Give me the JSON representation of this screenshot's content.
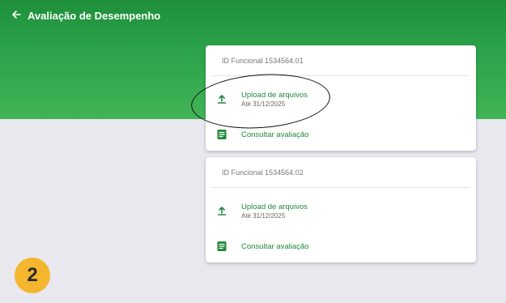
{
  "header": {
    "back_icon": "arrow-left-icon",
    "title": "Avaliação de Desempenho"
  },
  "cards": [
    {
      "id_label": "ID Funcional 1534564.01",
      "upload": {
        "icon": "upload-icon",
        "label": "Upload de arquivos",
        "deadline": "Até 31/12/2025"
      },
      "consult": {
        "icon": "document-icon",
        "label": "Consultar avaliação"
      }
    },
    {
      "id_label": "ID Funcional 1534564.02",
      "upload": {
        "icon": "upload-icon",
        "label": "Upload de arquivos",
        "deadline": "Até 31/12/2025"
      },
      "consult": {
        "icon": "document-icon",
        "label": "Consultar avaliação"
      }
    }
  ],
  "step_badge": "2",
  "colors": {
    "primary_green": "#2aa24a",
    "link_green": "#1e8a3b",
    "badge": "#f4b62f",
    "background": "#e9e8ee"
  }
}
